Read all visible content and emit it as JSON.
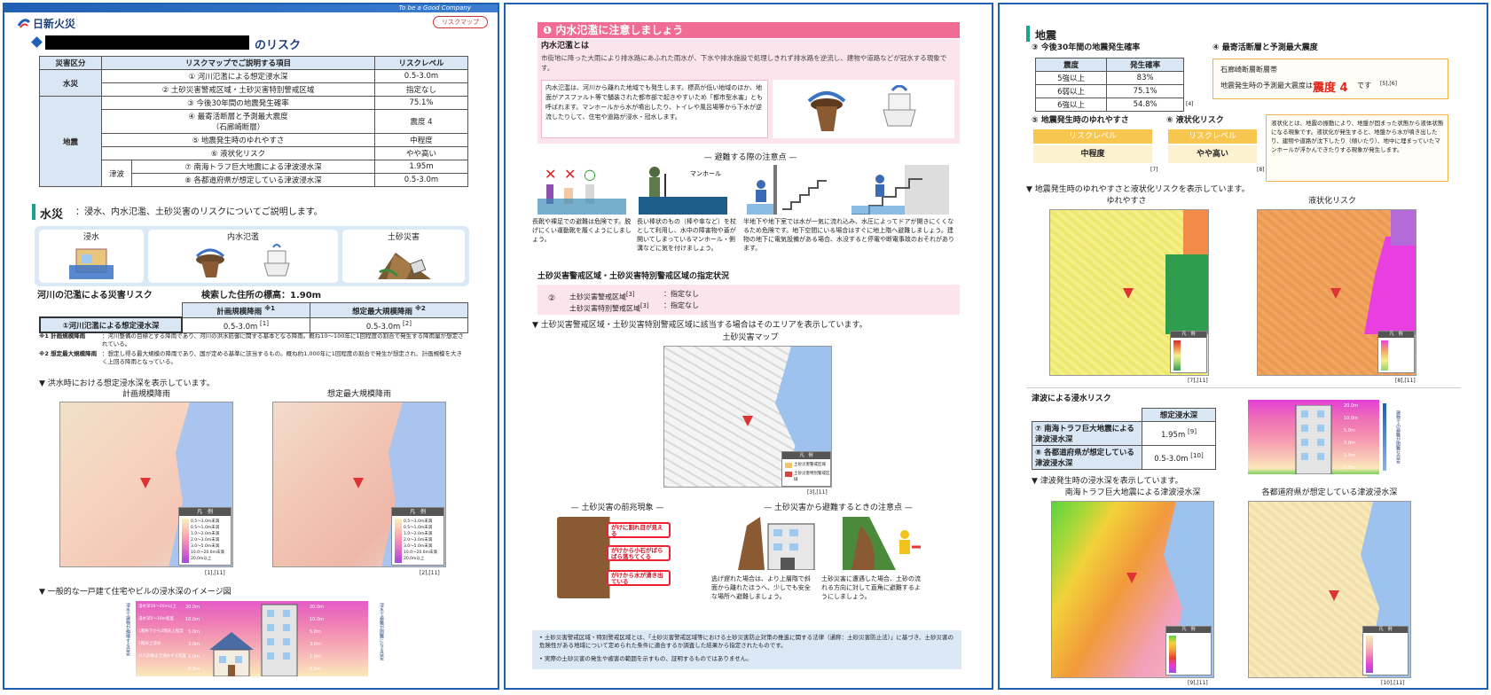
{
  "panel1": {
    "brand": "日新火災",
    "top_tagline": "To be a Good Company",
    "logo_badge": "リスクマップ",
    "page_title_suffix": "のリスク",
    "table": {
      "headers": [
        "災害区分",
        "リスクマップでご説明する項目",
        "リスクレベル"
      ],
      "cat_flood": "水災",
      "cat_quake": "地震",
      "sub_tsunami": "津波",
      "rows": [
        {
          "item": "① 河川氾濫による想定浸水深",
          "level": "0.5-3.0m"
        },
        {
          "item": "② 土砂災害警戒区域・土砂災害特別警戒区域",
          "level": "指定なし"
        },
        {
          "item": "③ 今後30年間の地震発生確率",
          "level": "75.1%"
        },
        {
          "item": "④ 最寄活断層と予測最大震度",
          "item2": "（石廊崎断層）",
          "level": "震度 4"
        },
        {
          "item": "⑤ 地震発生時のゆれやすさ",
          "level": "中程度"
        },
        {
          "item": "⑥ 液状化リスク",
          "level": "やや高い"
        },
        {
          "item": "⑦ 南海トラフ巨大地震による津波浸水深",
          "level": "1.95m"
        },
        {
          "item": "⑧ 各都道府県が想定している津波浸水深",
          "level": "0.5-3.0m"
        }
      ]
    },
    "water_section": {
      "title": "水災",
      "desc": "：浸水、内水氾濫、土砂災害のリスクについてご説明します。"
    },
    "cards": [
      "浸水",
      "内水氾濫",
      "土砂災害"
    ],
    "river": {
      "title": "河川の氾濫による災害リスク",
      "elevation": "検索した住所の標高：1.90m",
      "col1": "計画規模降雨",
      "col1_ref": "※1",
      "col2": "想定最大規模降雨",
      "col2_ref": "※2",
      "row_label": "①河川氾濫による想定浸水深",
      "val1": "0.5-3.0m",
      "val1_ref": "[1]",
      "val2": "0.5-3.0m",
      "val2_ref": "[2]"
    },
    "note1_label": "※1 計画規模降雨",
    "note1_text": "：河川整備の目標とする降雨であり、河川の洪水防御に関する基本となる降雨。概ね10～100年に1回程度の割合で発生する降雨量が想定されている。",
    "note2_label": "※2 想定最大規模降雨",
    "note2_text": "：想定し得る最大規模の降雨であり、国が定める基準に該当するもの。概ね約1,000年に1回程度の割合で発生が想定され、計画規模を大きく上回る降雨となっている。",
    "flood_caption": "▼ 洪水時における想定浸水深を表示しています。",
    "map1_title": "計画規模降雨",
    "map2_title": "想定最大規模降雨",
    "map1_ref": "[1],[11]",
    "map2_ref": "[2],[11]",
    "legend_title": "凡　例",
    "legend_items": [
      "0.5～3.0m未満",
      "0.5～1.0m未満",
      "1.0～2.0m未満",
      "2.0～3.0m未満",
      "3.0～5.0m未満",
      "10.0～20.0m未満",
      "20.0m以上"
    ],
    "house_caption": "▼ 一般的な一戸建て住宅やビルの浸水深のイメージ図",
    "depth_left": [
      "20.0m",
      "10.0m",
      "5.0m",
      "3.0m",
      "1.0m",
      "0.5m"
    ],
    "depth_right": [
      "20.0m",
      "10.0m",
      "5.0m",
      "3.0m",
      "1.0m",
      "0.5m"
    ],
    "depth_desc": [
      "浸水深10～20m以上",
      "浸水深5～10m程度",
      "1階軒下から2階床上程度",
      "1階床上浸水",
      "大人の膝まで浸水する程度"
    ],
    "arrow_left": "浸水で建物が損壊する目安",
    "arrow_right": "浸水で避難が困難になる目安"
  },
  "panel2": {
    "header_num": "❶",
    "header": "内水氾濫に注意しましょう",
    "what_title": "内水氾濫とは",
    "what_text": "市街地に降った大雨により排水路にあふれた雨水が、下水や排水施設で処理しきれず排水路を逆流し、建物や道路などが冠水する現象です。",
    "note_text": "内水氾濫は、河川から離れた地域でも発生します。標高が低い地域のほか、地面がアスファルト等で舗装された都市部で起きやすいため「都市型水害」とも呼ばれます。マンホールから水が噴出したり、トイレや風呂場等から下水が逆流したりして、住宅や道路が浸水・冠水します。",
    "evac_title": "避難する際の注意点",
    "evac_items": [
      "長靴や裸足での避難は危険です。脱げにくい運動靴を履くようにしましょう。",
      "長い棒状のもの（棒や傘など）を杖として利用し、水中の障害物や蓋が開いてしまっているマンホール・側溝などに気を付けましょう。",
      "半地下や地下室では水が一気に流れ込み、水圧によってドアが開きにくくなるため危険です。地下空間にいる場合はすぐに地上階へ避難しましょう。建物の地下に電気設備がある場合、水没すると停電や断電事故のおそれがあります。"
    ],
    "manhole_label": "マンホール",
    "sediment_title": "土砂災害警戒区域・土砂災害特別警戒区域の指定状況",
    "sediment_num": "②",
    "sediment_rows": [
      {
        "label": "土砂災害警戒区域",
        "ref": "[3]",
        "value": "：指定なし"
      },
      {
        "label": "土砂災害特別警戒区域",
        "ref": "[3]",
        "value": "：指定なし"
      }
    ],
    "area_caption": "▼ 土砂災害警戒区域・土砂災害特別警戒区域に該当する場合はそのエリアを表示しています。",
    "map_title": "土砂災害マップ",
    "map_ref": "[3],[11]",
    "legend_title": "凡　例",
    "legend_items": [
      "土砂災害警戒区域",
      "土砂災害特別警戒区域"
    ],
    "sign_title": "土砂災害の前兆現象",
    "sign_items": [
      "がけに割れ目が見える",
      "がけから小石がばらばら落ちてくる",
      "がけから水が湧き出ている"
    ],
    "avoid_title": "土砂災害から避難するときの注意点",
    "avoid_items": [
      "逃げ遅れた場合は、より上層階で斜面から離れたほうへ、少しでも安全な場所へ避難しましょう。",
      "土砂災害に遭遇した場合、土砂の流れる方向に対して直角に避難するようにしましょう。"
    ],
    "footer_notes": [
      "土砂災害警戒区域・特別警戒区域とは、「土砂災害警戒区域等における土砂災害防止対策の推進に関する法律（通称：土砂災害防止法）」に基づき、土砂災害の危険性がある地域について定められた条件に適合するか調査した結果から指定されたものです。",
      "実際の土砂災害の発生や被害の範囲を示すもの、証明するものではありません。"
    ]
  },
  "panel3": {
    "section": "地震",
    "prob_title": "③ 今後30年間の地震発生確率",
    "prob_headers": [
      "震度",
      "発生確率"
    ],
    "prob_rows": [
      [
        "5強以上",
        "83%"
      ],
      [
        "6弱以上",
        "75.1%"
      ],
      [
        "6強以上",
        "54.8%"
      ]
    ],
    "prob_ref": "[4]",
    "fault_title": "④ 最寄活断層と予測最大震度",
    "fault_name": "石廊崎断層断層帯",
    "fault_text_pre": "地震発生時の予測最大震度は",
    "fault_level": "震度 4",
    "fault_text_post": "です",
    "fault_ref": "[5],[6]",
    "shake_title": "⑤ 地震発生時のゆれやすさ",
    "liq_title": "⑥ 液状化リスク",
    "level_label": "リスクレベル",
    "shake_value": "中程度",
    "liq_value": "やや高い",
    "shake_ref": "[7]",
    "liq_ref": "[8]",
    "liq_desc": "液状化とは、地震の振動により、地盤が固まった状態から液体状態になる現象です。液状化が発生すると、地盤から水が噴き出したり、建物や道路が沈下したり（傾いたり）、地中に埋まっていたマンホールが浮かんできたりする現象が発生します。",
    "map_caption": "▼ 地震発生時のゆれやすさと液状化リスクを表示しています。",
    "map1_title": "ゆれやすさ",
    "map2_title": "液状化リスク",
    "map1_ref": "[7],[11]",
    "map2_ref": "[8],[11]",
    "legend_title": "凡　例",
    "tsunami_title": "津波による浸水リスク",
    "tsunami_header": "想定浸水深",
    "tsunami_rows": [
      {
        "label": "⑦ 南海トラフ巨大地震による津波浸水深",
        "value": "1.95m",
        "ref": "[9]"
      },
      {
        "label": "⑧ 各都道府県が想定している津波浸水深",
        "value": "0.5-3.0m",
        "ref": "[10]"
      }
    ],
    "tsunami_caption": "▼ 津波発生時の浸水深を表示しています。",
    "map3_title": "南海トラフ巨大地震による津波浸水深",
    "map4_title": "各都道府県が想定している津波浸水深",
    "map3_ref": "[9],[11]",
    "map4_ref": "[10],[11]",
    "depth_labels": [
      "20.0m",
      "10.0m",
      "5.0m",
      "3.0m",
      "1.0m",
      "0.5m"
    ],
    "arrow_text": "建物での避難が困難な目安"
  }
}
